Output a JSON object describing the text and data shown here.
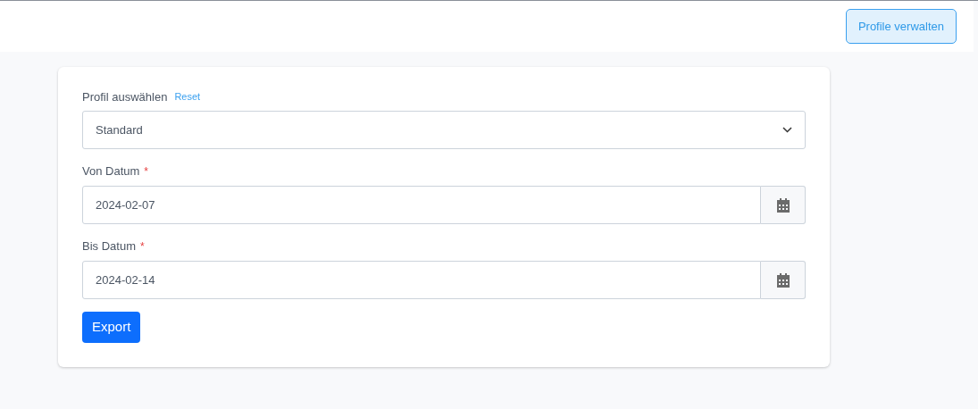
{
  "header": {
    "button": "Profile verwalten"
  },
  "form": {
    "profile": {
      "label": "Profil auswählen",
      "reset_link": "Reset",
      "value": "Standard"
    },
    "dates": [
      {
        "label": "Von Datum",
        "required_mark": "*",
        "value": "2024-02-07"
      },
      {
        "label": "Bis Datum",
        "required_mark": "*",
        "value": "2024-02-14"
      }
    ],
    "submit": "Export"
  }
}
